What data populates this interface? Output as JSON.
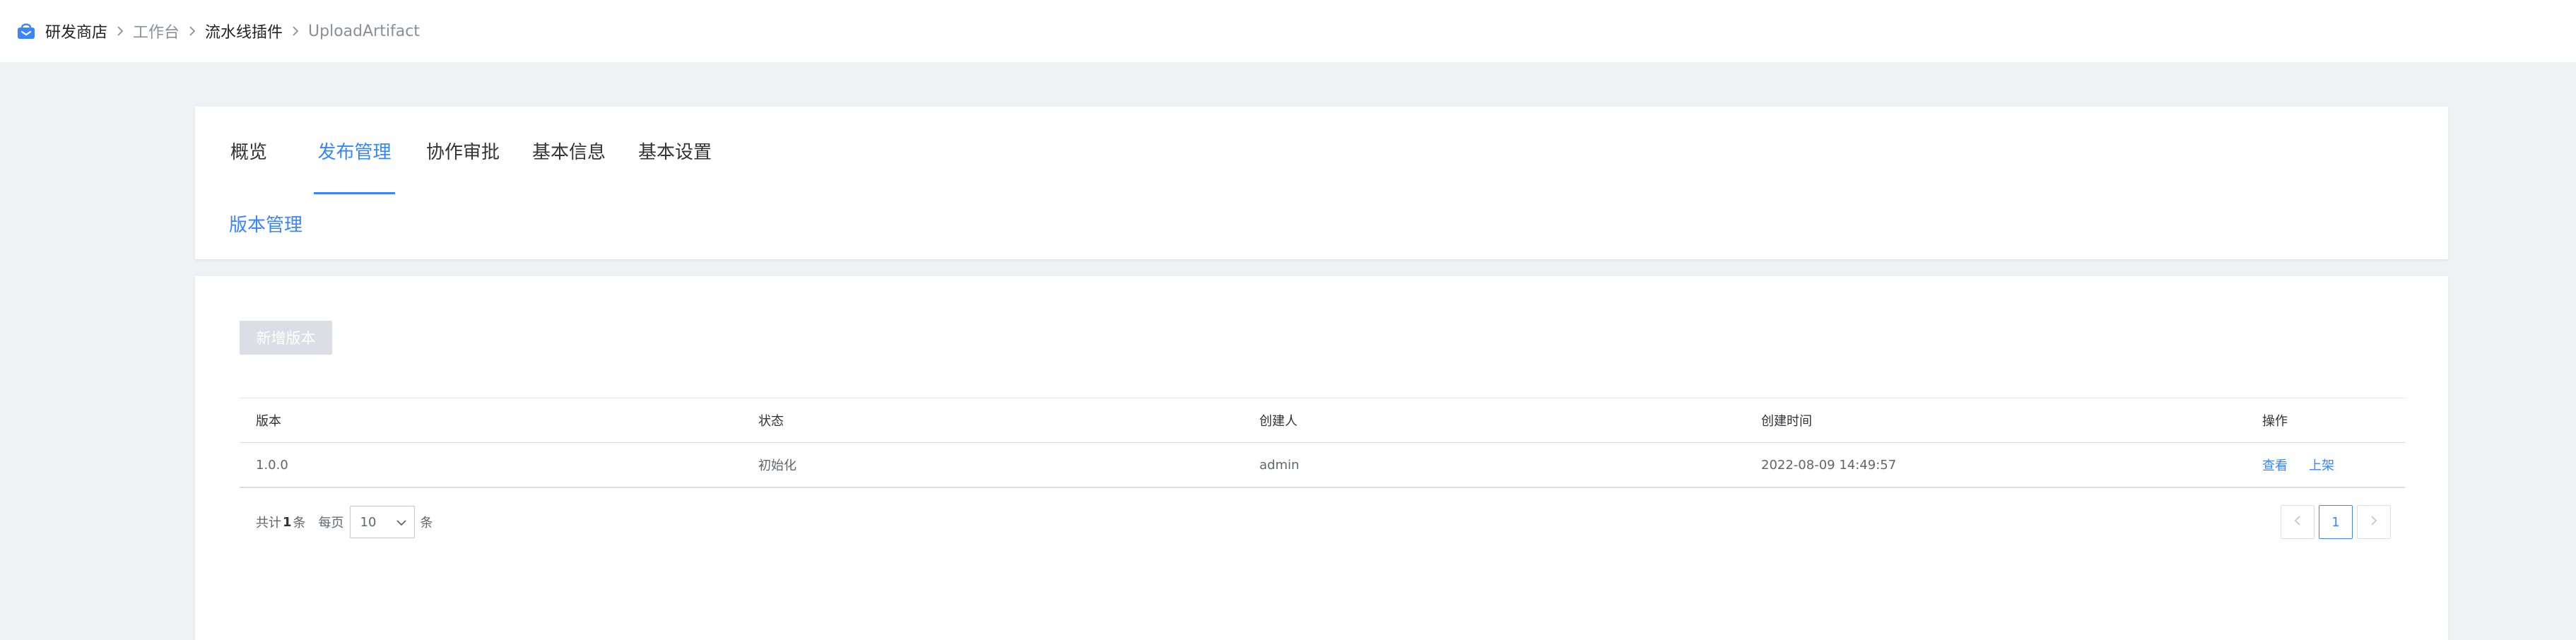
{
  "header": {
    "breadcrumb": [
      "研发商店",
      "工作台",
      "流水线插件",
      "UploadArtifact"
    ],
    "logo_icon": "store-basket-icon",
    "colors": {
      "logo": "#3a84ff"
    }
  },
  "tabs": {
    "items": [
      "概览",
      "发布管理",
      "协作审批",
      "基本信息",
      "基本设置"
    ],
    "active_index": 1,
    "sub_tab": "版本管理"
  },
  "content": {
    "new_version_button": "新增版本",
    "table": {
      "headers": [
        "版本",
        "状态",
        "创建人",
        "创建时间",
        "操作"
      ],
      "rows": [
        {
          "version": "1.0.0",
          "status": "初始化",
          "creator": "admin",
          "created_at": "2022-08-09 14:49:57",
          "actions": [
            "查看",
            "上架"
          ]
        }
      ]
    },
    "pagination": {
      "total_prefix": "共计",
      "total_count": "1",
      "total_suffix": "条",
      "per_page_label": "每页",
      "page_size": "10",
      "per_page_unit": "条",
      "current_page": "1"
    }
  },
  "colors": {
    "accent": "#3a84ff",
    "page_bg": "#f0f1f5",
    "disabled_button": "#dcdee5"
  }
}
